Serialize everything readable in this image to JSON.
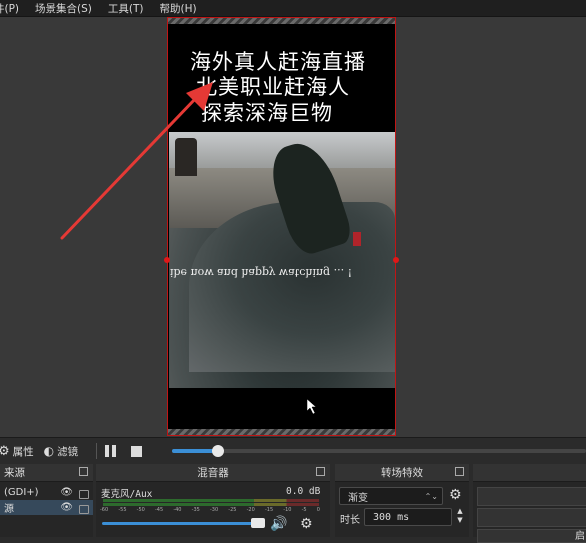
{
  "menu": [
    "件(P)",
    "场景集合(S)",
    "工具(T)",
    "帮助(H)"
  ],
  "captions": [
    "海外真人赶海直播",
    "北美职业赶海人",
    "探索深海巨物"
  ],
  "video_subtitle_mirrored": "ibe now and happy watching ... !",
  "controls": {
    "properties_label": "属性",
    "filters_label": "滤镜",
    "seek_progress": 0.11
  },
  "docks": {
    "sources_title": "来源",
    "mixer_title": "混音器",
    "transitions_title": "转场特效"
  },
  "sources": [
    {
      "label": "(GDI+)",
      "selected": false
    },
    {
      "label": "源",
      "selected": true
    }
  ],
  "mixer": {
    "channel_name": "麦克风/Aux",
    "level_db": "0.0 dB",
    "scale_ticks": [
      "-60",
      "-55",
      "-50",
      "-45",
      "-40",
      "-35",
      "-30",
      "-25",
      "-20",
      "-15",
      "-10",
      "-5",
      "0"
    ]
  },
  "transitions": {
    "selected": "渐变",
    "duration_label": "时长",
    "duration_value": "300 ms"
  },
  "right_panel_text": "启",
  "icons": [
    "gear-icon",
    "filter-icon",
    "pause-icon",
    "stop-icon",
    "eye-icon",
    "lock-icon",
    "speaker-icon",
    "float-icon",
    "chevron-updown-icon"
  ],
  "colors": {
    "accent": "#3b8fd6",
    "selection_border": "#c01515",
    "arrow": "#e53935"
  }
}
